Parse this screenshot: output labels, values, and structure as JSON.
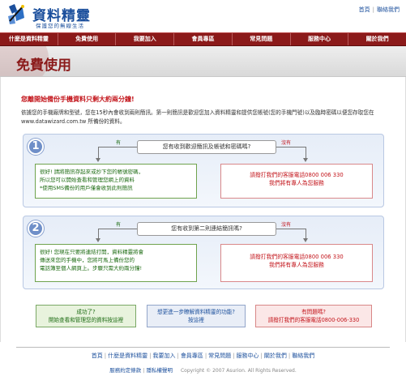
{
  "header": {
    "logo_title": "資料精靈",
    "logo_sub": "保護您的無線生活",
    "top_links": [
      "首頁",
      "聯絡我們"
    ]
  },
  "nav": {
    "items": [
      "什麼是資料精靈",
      "免費使用",
      "我要加入",
      "會員專區",
      "常見問題",
      "服務中心",
      "關於我們"
    ]
  },
  "banner": {
    "title": "免費使用"
  },
  "main": {
    "heading": "您離開始備份手機資料只剩大約兩分鐘!",
    "intro": "依據您的手機廠牌和型號，您在15秒內會收到兩則簡訊。第一則簡訊是歡迎您加入資料精靈和提供您帳號(您的手機門號)以及臨時密碼以便您存取您在 www.datawizard.com.tw 所備份的資料。"
  },
  "step1": {
    "num": "1",
    "question": "您有收到歡迎簡訊及帳號和密碼嗎?",
    "yes_label": "有",
    "no_label": "沒有",
    "yes_text_1": "很好! 請將簡訊存起來或抄下您的帳號密碼，",
    "yes_text_2": "所以您可以開始查看和管理您網上的資料",
    "yes_text_3": "*使用SMS備份的用戶僅會收到此則簡訊",
    "no_text_1": "請撥打我們的客服電話0800 006 330",
    "no_text_2": "我們將有專人為您服務"
  },
  "step2": {
    "num": "2",
    "question": "您有收到第二則連結簡訊嗎?",
    "yes_label": "有",
    "no_label": "沒有",
    "yes_text_1": "很好! 您現在只要將連結打開，資料精靈將會",
    "yes_text_2": "傳送來您的手機中，您將可馬上備份您的",
    "yes_text_3": "電話簿至個人網頁上。步驟只需大約兩分鐘!",
    "no_text_1": "請撥打我們的客服電話0800 006 330",
    "no_text_2": "我們將有專人為您服務"
  },
  "buttons": {
    "b1_line1": "成功了?",
    "b1_line2": "開始查看和管理您的資料按這裡",
    "b2_line1": "想更進一步瞭解資料精靈的功能?",
    "b2_line2": "按這裡",
    "b3_line1": "有問題嗎?",
    "b3_line2": "請撥打我們的客服電話0800-006-330"
  },
  "footer": {
    "links": [
      "首頁",
      "什麼是資料精靈",
      "我要加入",
      "會員專區",
      "常見問題",
      "服務中心",
      "關於我們",
      "聯絡我們"
    ],
    "terms": "服務約定條款",
    "privacy": "隱私權聲明",
    "copyright": "Copyright © 2007 Asurion. All Rights Reserved."
  },
  "colors": {
    "nav_bg": "#8b1a1a",
    "link_blue": "#1b4f9c",
    "alert_red": "#c3161c",
    "ok_green": "#1c6b12"
  }
}
